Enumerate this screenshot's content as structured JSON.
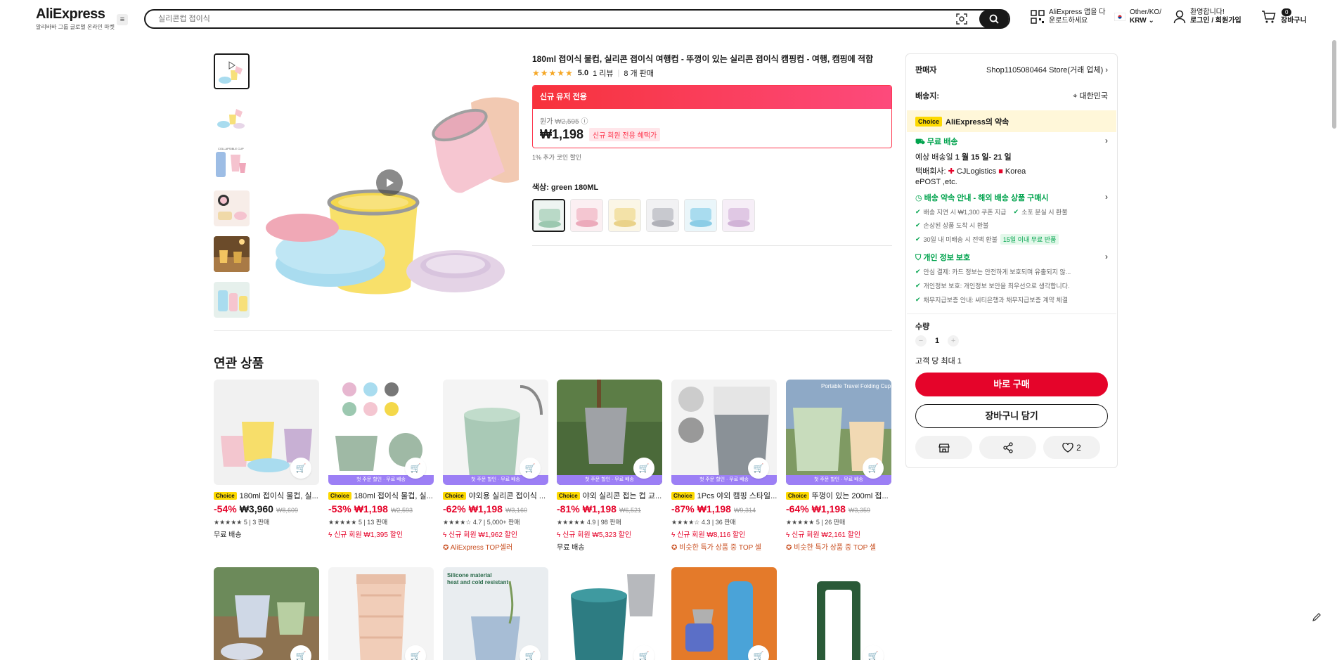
{
  "header": {
    "logo": "AliExpress",
    "logo_sub": "알리바바 그룹 글로벌 온라인 마켓",
    "search_placeholder": "실리콘컵 접이식",
    "app_line1": "AliExpress 앱을 다",
    "app_line2": "운로드하세요",
    "region_line1": "Other/KO/",
    "region_line2": "KRW",
    "account_line1": "환영합니다!",
    "account_line2": "로그인 / 회원가입",
    "cart_count": "0",
    "cart_label": "장바구니"
  },
  "product": {
    "title": "180ml 접이식 물컵, 실리콘 접이식 여행컵 - 뚜껑이 있는 실리콘 접이식 캠핑컵 - 여행, 캠핑에 적합",
    "stars": "★★★★★",
    "rating": "5.0",
    "reviews": "1 리뷰",
    "sold": "8 개 판매",
    "deal_label": "신규 유저 전용",
    "orig_label": "원가",
    "orig_price": "₩2,595",
    "price": "₩1,198",
    "new_member_tag": "신규 회원 전용 혜택가",
    "coin_note": "1% 추가 코인 할인",
    "color_label": "색상: green 180ML"
  },
  "panel": {
    "seller_label": "판매자",
    "seller_name": "Shop1105080464 Store(거래 업체)",
    "ship_to_label": "배송지:",
    "ship_to": "대한민국",
    "choice_badge": "Choice",
    "promise": "AliExpress의 약속",
    "free_ship": "무료 배송",
    "eta_prefix": "예상 배송일",
    "eta": "1 월 15 일- 21 일",
    "courier_prefix": "택배회사:",
    "courier1": "CJLogistics",
    "courier2": "Korea",
    "courier3": "ePOST ,etc.",
    "delivery_title": "배송 약속 안내 - 해외 배송 상품 구매시",
    "d1": "배송 지연 시 ₩1,300 쿠폰 지급",
    "d2": "소포 분실 시 환불",
    "d3": "손상된 상품 도착 시 환불",
    "d4": "30일 내 미배송 시 전액 환불",
    "d4_tag": "15일 이내 무료 반품",
    "privacy_title": "개인 정보 보호",
    "p1": "안심 결제: 카드 정보는 안전하게 보호되며 유출되지 않...",
    "p2": "개인정보 보호: 개인정보 보안을 최우선으로 생각합니다.",
    "p3": "채무지급보증 안내: 씨티은행과 채무지급보증 계약 체결",
    "qty_label": "수량",
    "qty": "1",
    "max_note": "고객 당 최대 1",
    "buy_now": "바로 구매",
    "add_cart": "장바구니 담기",
    "wish_count": "2"
  },
  "related": {
    "title": "연관 상품",
    "strip": "첫 주문 할인 · 무료 배송",
    "choice": "Choice",
    "items": [
      {
        "name": "180ml 접이식 물컵, 실...",
        "disc": "-54%",
        "price": "₩3,960",
        "orig": "₩8,609",
        "stars": "★★★★★",
        "rate": "5 | 3 판매",
        "extra": "무료 배송"
      },
      {
        "name": "180ml 접이식 물컵, 실...",
        "disc": "-53%",
        "price": "₩1,198",
        "orig": "₩2,593",
        "stars": "★★★★★",
        "rate": "5 | 13 판매",
        "extra": "신규 회원 ₩1,395 할인"
      },
      {
        "name": "야외용 실리콘 접이식 ...",
        "disc": "-62%",
        "price": "₩1,198",
        "orig": "₩3,160",
        "stars": "★★★★☆",
        "rate": "4.7 | 5,000+ 판매",
        "extra": "신규 회원 ₩1,962 할인",
        "extra2": "AliExpress TOP셀러"
      },
      {
        "name": "야외 실리콘 접는 컵 교...",
        "disc": "-81%",
        "price": "₩1,198",
        "orig": "₩6,521",
        "stars": "★★★★★",
        "rate": "4.9 | 98 판매",
        "extra": "신규 회원 ₩5,323 할인",
        "extra2": "무료 배송"
      },
      {
        "name": "1Pcs 야외 캠핑 스타일...",
        "disc": "-87%",
        "price": "₩1,198",
        "orig": "₩9,314",
        "stars": "★★★★☆",
        "rate": "4.3 | 36 판매",
        "extra": "신규 회원 ₩8,116 할인",
        "extra2": "비슷한 특가 상품 중 TOP 셀"
      },
      {
        "name": "뚜껑이 있는 200ml 접...",
        "disc": "-64%",
        "price": "₩1,198",
        "orig": "₩3,359",
        "stars": "★★★★★",
        "rate": "5 | 26 판매",
        "extra": "신규 회원 ₩2,161 할인",
        "extra2": "비슷한 특가 상품 중 TOP 셀"
      }
    ]
  }
}
